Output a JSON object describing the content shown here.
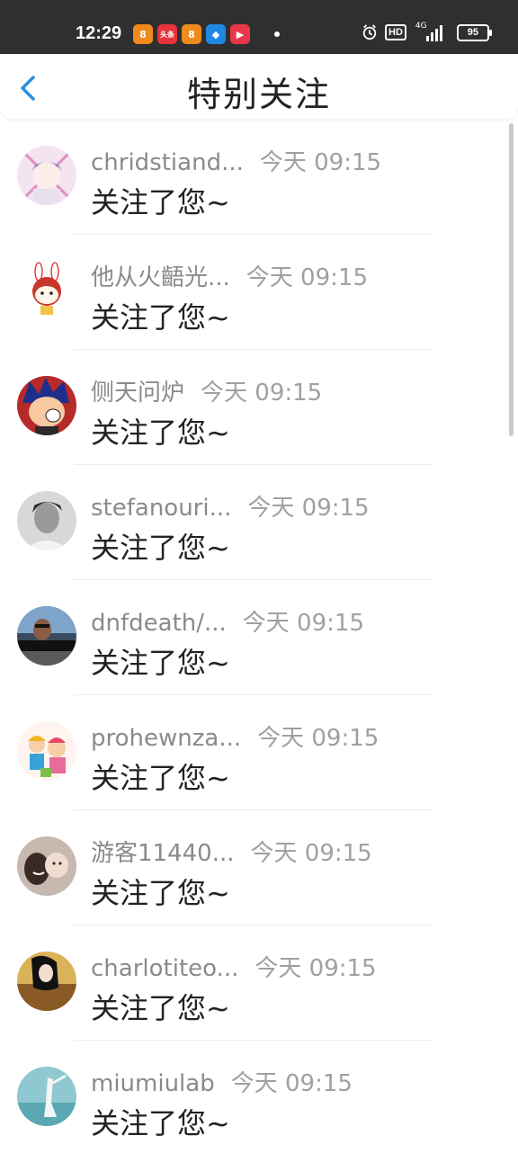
{
  "status_bar": {
    "time": "12:29",
    "app_icons": [
      {
        "name": "app-icon-1",
        "glyph": "8",
        "color": "#f08a1d"
      },
      {
        "name": "toutiao-icon",
        "glyph": "头条",
        "color": "#e8323c"
      },
      {
        "name": "app-icon-3",
        "glyph": "8",
        "color": "#f08a1d"
      },
      {
        "name": "app-icon-4",
        "glyph": "◆",
        "color": "#1e88e5"
      },
      {
        "name": "app-icon-5",
        "glyph": "▶",
        "color": "#e8384a"
      }
    ],
    "hd": "HD",
    "network": "4G",
    "battery": "95"
  },
  "header": {
    "title": "特别关注"
  },
  "items": [
    {
      "name": "chridstiand...",
      "time": "今天 09:15",
      "message": "关注了您~"
    },
    {
      "name": "他从火齬光...",
      "time": "今天 09:15",
      "message": "关注了您~"
    },
    {
      "name": "侧天问炉",
      "time": "今天 09:15",
      "message": "关注了您~"
    },
    {
      "name": "stefanouri...",
      "time": "今天 09:15",
      "message": "关注了您~"
    },
    {
      "name": "dnfdeath/...",
      "time": "今天 09:15",
      "message": "关注了您~"
    },
    {
      "name": "prohewnza...",
      "time": "今天 09:15",
      "message": "关注了您~"
    },
    {
      "name": "游客11440...",
      "time": "今天 09:15",
      "message": "关注了您~"
    },
    {
      "name": "charlotiteo...",
      "time": "今天 09:15",
      "message": "关注了您~"
    },
    {
      "name": "miumiulab",
      "time": "今天 09:15",
      "message": "关注了您~"
    }
  ],
  "colors": {
    "accent": "#2b8fe0",
    "status_bar_bg": "#2f2f2f",
    "name_text": "#8a8a8a",
    "message_text": "#222222"
  }
}
